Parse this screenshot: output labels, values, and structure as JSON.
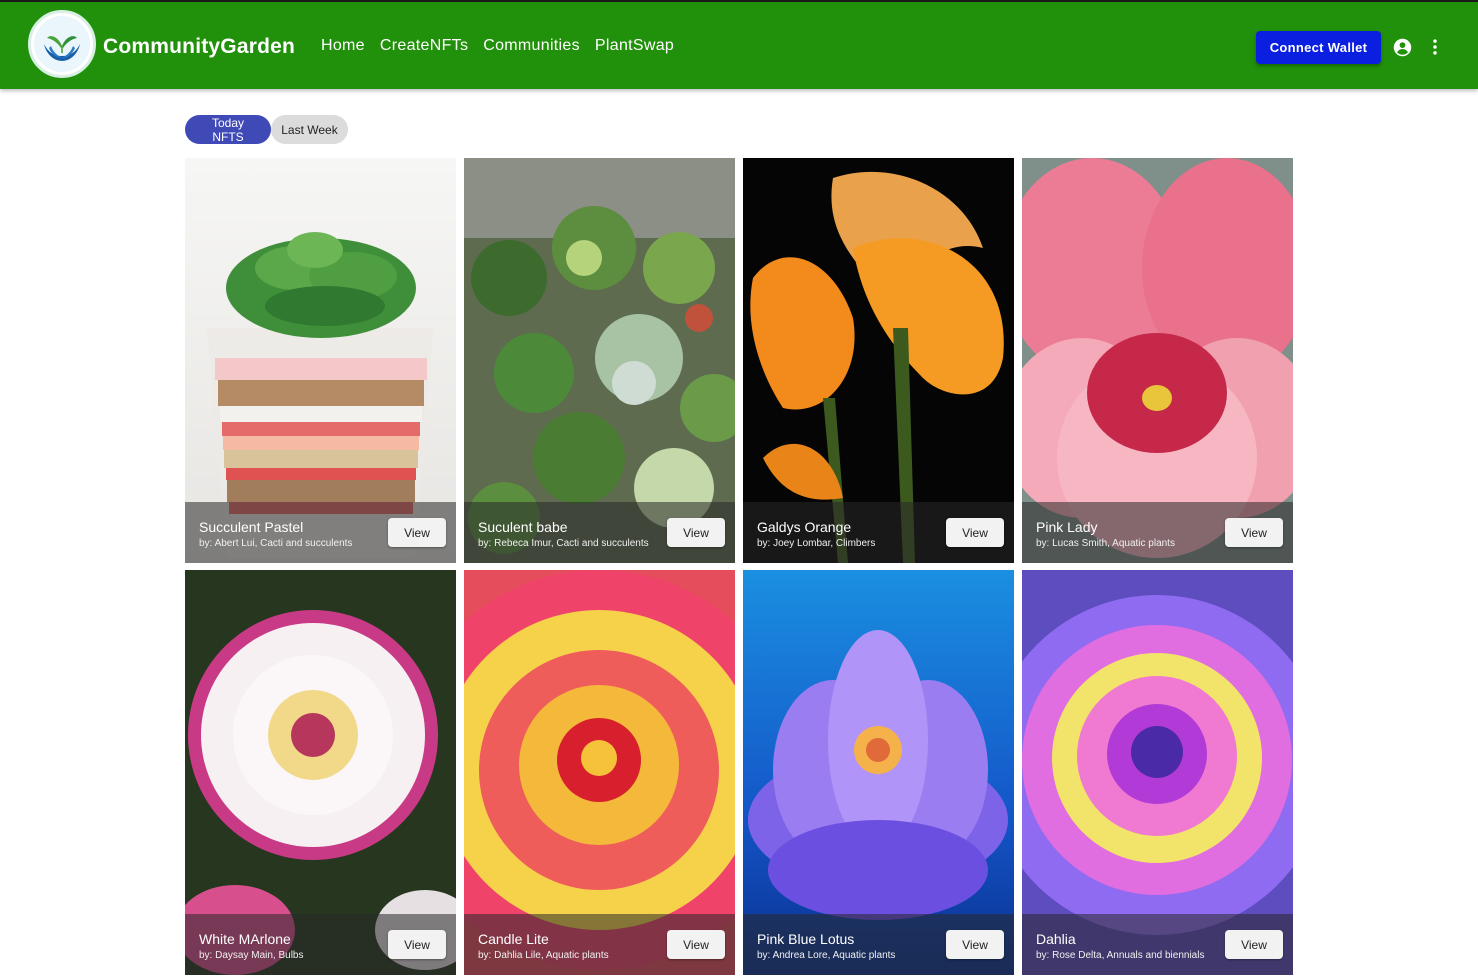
{
  "header": {
    "brand": "CommunityGarden",
    "nav": [
      "Home",
      "CreateNFTs",
      "Communities",
      "PlantSwap"
    ],
    "connect_label": "Connect Wallet",
    "icons": {
      "logo": "hands-sprout-logo",
      "account": "account-circle-icon",
      "more": "more-vert-icon"
    }
  },
  "filters": {
    "today": "Today NFTS",
    "last_week": "Last Week",
    "selected": "today"
  },
  "view_label": "View",
  "cards": [
    {
      "title": "Succulent Pastel",
      "subtitle": "by: Abert Lui, Cacti and succulents"
    },
    {
      "title": "Suculent babe",
      "subtitle": "by: Rebeca Imur, Cacti and succulents"
    },
    {
      "title": "Galdys Orange",
      "subtitle": "by: Joey Lombar, Climbers"
    },
    {
      "title": "Pink Lady",
      "subtitle": "by: Lucas Smith, Aquatic plants"
    },
    {
      "title": "White MArlone",
      "subtitle": "by: Daysay Main, Bulbs"
    },
    {
      "title": "Candle Lite",
      "subtitle": "by: Dahlia Lile, Aquatic plants"
    },
    {
      "title": "Pink Blue Lotus",
      "subtitle": "by: Andrea Lore, Aquatic plants"
    },
    {
      "title": "Dahlia",
      "subtitle": "by: Rose Delta, Annuals and biennials"
    }
  ],
  "colors": {
    "appbar": "#21900a",
    "connect_button": "#0a1fe0",
    "active_chip": "#3f4ab7"
  }
}
